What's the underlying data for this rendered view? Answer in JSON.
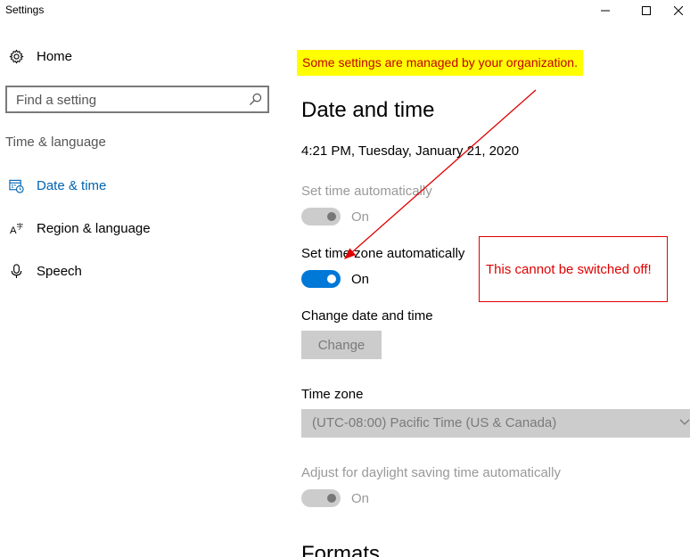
{
  "window": {
    "title": "Settings"
  },
  "sidebar": {
    "home_label": "Home",
    "search_placeholder": "Find a setting",
    "section_label": "Time & language",
    "items": [
      {
        "label": "Date & time",
        "icon": "calendar-clock-icon",
        "active": true
      },
      {
        "label": "Region & language",
        "icon": "language-icon",
        "active": false
      },
      {
        "label": "Speech",
        "icon": "microphone-icon",
        "active": false
      }
    ]
  },
  "main": {
    "banner": "Some settings are managed by your organization.",
    "title": "Date and time",
    "current_datetime": "4:21 PM, Tuesday, January 21, 2020",
    "set_time_auto": {
      "label": "Set time automatically",
      "state": "On",
      "enabled": false
    },
    "set_timezone_auto": {
      "label": "Set time zone automatically",
      "state": "On",
      "enabled": true
    },
    "change_date_time": {
      "label": "Change date and time",
      "button_label": "Change"
    },
    "time_zone": {
      "label": "Time zone",
      "value": "(UTC-08:00) Pacific Time (US & Canada)"
    },
    "daylight_saving": {
      "label": "Adjust for daylight saving time automatically",
      "state": "On",
      "enabled": false
    },
    "formats_heading": "Formats"
  },
  "annotation": {
    "text": "This cannot be switched off!",
    "color": "#e00000"
  },
  "colors": {
    "accent": "#0078d7",
    "active_nav": "#0063b1",
    "banner_bg": "#ffff00",
    "banner_text": "#c00000"
  }
}
